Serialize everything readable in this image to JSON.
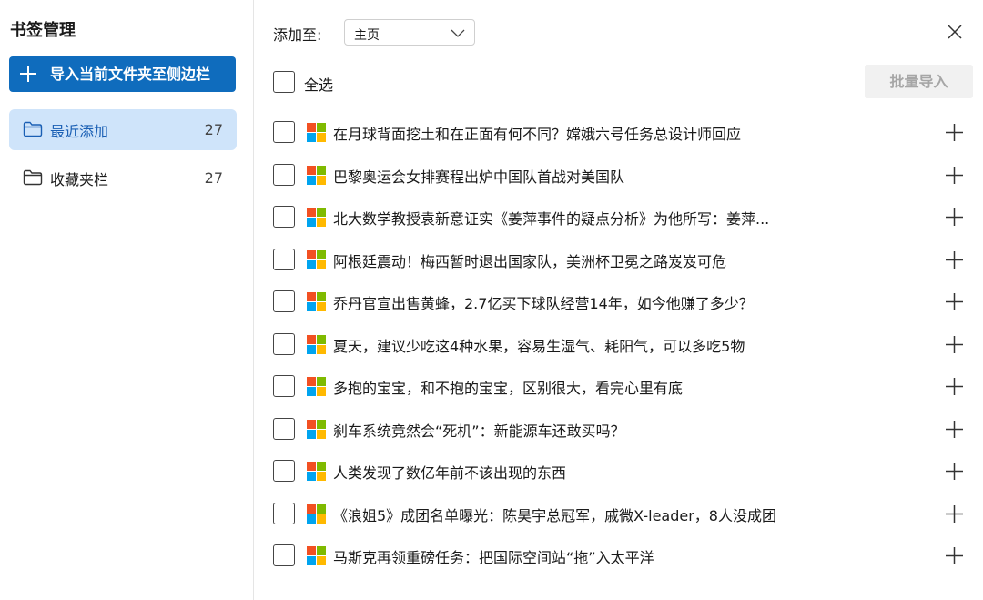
{
  "sidebar": {
    "title": "书签管理",
    "import_button": "导入当前文件夹至侧边栏",
    "items": [
      {
        "label": "最近添加",
        "count": "27"
      },
      {
        "label": "收藏夹栏",
        "count": "27"
      }
    ]
  },
  "header": {
    "add_to_label": "添加至:",
    "target_folder": "主页"
  },
  "toolbar": {
    "select_all_label": "全选",
    "batch_import_label": "批量导入"
  },
  "bookmarks": [
    {
      "title": "在月球背面挖土和在正面有何不同？嫦娥六号任务总设计师回应"
    },
    {
      "title": "巴黎奥运会女排赛程出炉中国队首战对美国队"
    },
    {
      "title": "北大数学教授袁新意证实《姜萍事件的疑点分析》为他所写：姜萍..."
    },
    {
      "title": "阿根廷震动！梅西暂时退出国家队，美洲杯卫冕之路岌岌可危"
    },
    {
      "title": "乔丹官宣出售黄蜂，2.7亿买下球队经营14年，如今他赚了多少？"
    },
    {
      "title": "夏天，建议少吃这4种水果，容易生湿气、耗阳气，可以多吃5物"
    },
    {
      "title": "多抱的宝宝，和不抱的宝宝，区别很大，看完心里有底"
    },
    {
      "title": "刹车系统竟然会“死机”：新能源车还敢买吗？"
    },
    {
      "title": "人类发现了数亿年前不该出现的东西"
    },
    {
      "title": "《浪姐5》成团名单曝光：陈昊宇总冠军，戚微X-leader，8人没成团"
    },
    {
      "title": "马斯克再领重磅任务：把国际空间站“拖”入太平洋"
    }
  ],
  "colors": {
    "accent": "#0f6cbd",
    "active_nav_bg": "#cfe4fa",
    "ms_red": "#f25022",
    "ms_green": "#7fba00",
    "ms_blue": "#00a4ef",
    "ms_yellow": "#ffb900"
  }
}
